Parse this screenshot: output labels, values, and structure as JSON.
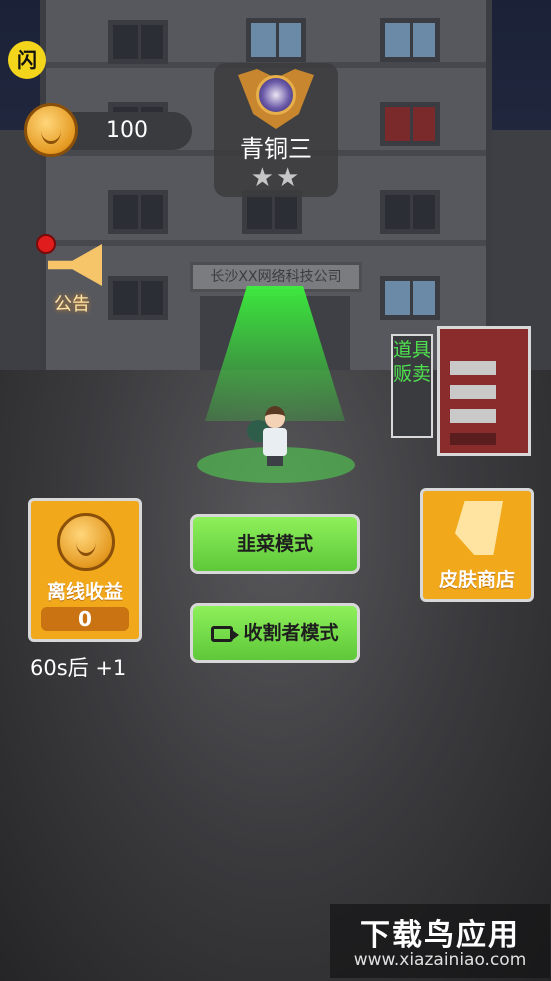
{
  "hud": {
    "flash_badge": "闪",
    "coins": "100",
    "rank_title": "青铜三",
    "rank_stars": "★★",
    "notice_label": "公告"
  },
  "scene": {
    "building_sign": "长沙XX网络科技公司"
  },
  "shop": {
    "vending_label": "道具贩卖",
    "skin_shop_label": "皮肤商店"
  },
  "offline": {
    "label": "离线收益",
    "value": "0",
    "timer": "60s后 +1"
  },
  "modes": {
    "normal": "韭菜模式",
    "reaper": "收割者模式"
  },
  "watermark": {
    "big": "下载鸟应用",
    "small": "www.xiazainiao.com"
  },
  "icons": {
    "coin": "coin-icon",
    "rank": "bronze-rank-emblem-icon",
    "notice": "megaphone-icon",
    "video": "video-camera-icon",
    "skin": "skin-shape-icon"
  },
  "colors": {
    "accent_orange": "#f2a81b",
    "mode_green": "#8ef05a",
    "vending_text": "#4ee04e"
  }
}
